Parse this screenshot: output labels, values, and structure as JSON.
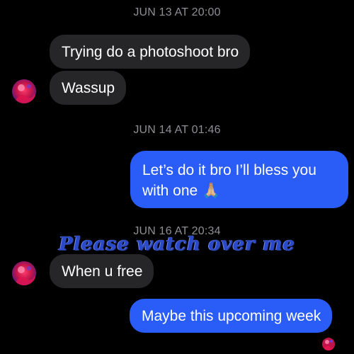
{
  "conversation": {
    "timestamps": [
      "JUN 13 AT 20:00",
      "JUN 14 AT 01:46",
      "JUN 16 AT 20:34"
    ],
    "messages": [
      {
        "from": "them",
        "text": "Trying do a photoshoot bro"
      },
      {
        "from": "them",
        "text": "Wassup"
      },
      {
        "from": "me",
        "text": "Let’s do it bro I’ll bless you with one 🙏🏼"
      },
      {
        "from": "them",
        "text": "When u free"
      },
      {
        "from": "me",
        "text": "Maybe this upcoming week"
      }
    ]
  },
  "overlay": {
    "text": "Please watch over me"
  },
  "colors": {
    "background": "#000000",
    "incoming_bubble": "#262628",
    "outgoing_bubble": "#2a5cf7",
    "timestamp": "#8e8e93",
    "overlay_text": "#2a49c9"
  },
  "icons": {
    "avatar": "contact-avatar-icon",
    "read_receipt": "read-receipt-avatar-icon"
  }
}
